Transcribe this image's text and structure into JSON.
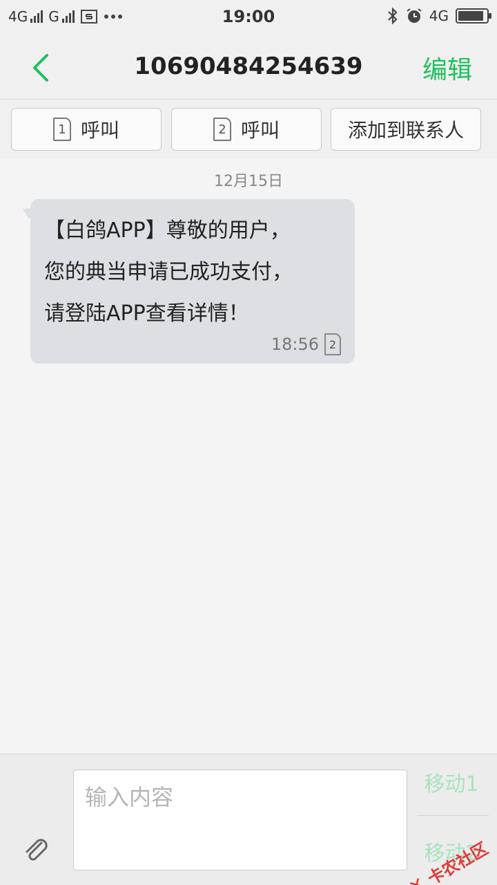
{
  "status_bar": {
    "network1": "4G",
    "network2": "G",
    "time": "19:00",
    "network_right": "4G",
    "battery_level": 0.9
  },
  "header": {
    "title": "10690484254639",
    "edit_label": "编辑"
  },
  "actions": {
    "call1_sim": "1",
    "call1_label": "呼叫",
    "call2_sim": "2",
    "call2_label": "呼叫",
    "add_contact_label": "添加到联系人"
  },
  "messages": [
    {
      "date": "12月15日",
      "text": "【白鸽APP】尊敬的用户，\n您的典当申请已成功支付，\n请登陆APP查看详情！",
      "time": "18:56",
      "sim": "2"
    }
  ],
  "compose": {
    "placeholder": "输入内容",
    "send1_label": "移动1",
    "send2_label": "移动2"
  },
  "watermark": {
    "text": "卡农社区"
  },
  "colors": {
    "accent": "#1fbf5a",
    "send_disabled": "#a8e2bd",
    "bubble": "#dcdfe3"
  }
}
